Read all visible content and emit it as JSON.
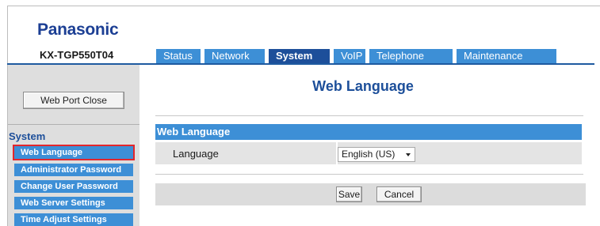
{
  "header": {
    "brand": "Panasonic",
    "model": "KX-TGP550T04"
  },
  "tabs": [
    {
      "label": "Status"
    },
    {
      "label": "Network"
    },
    {
      "label": "System"
    },
    {
      "label": "VoIP"
    },
    {
      "label": "Telephone"
    },
    {
      "label": "Maintenance"
    }
  ],
  "sidebar": {
    "port_button": "Web Port Close",
    "section_title": "System",
    "items": [
      {
        "label": "Web Language"
      },
      {
        "label": "Administrator Password"
      },
      {
        "label": "Change User Password"
      },
      {
        "label": "Web Server Settings"
      },
      {
        "label": "Time Adjust Settings"
      }
    ]
  },
  "main": {
    "page_title": "Web Language",
    "section_title": "Web Language",
    "language_label": "Language",
    "language_value": "English (US)",
    "save_label": "Save",
    "cancel_label": "Cancel"
  },
  "colors": {
    "brand": "#1c3f94",
    "tab": "#3d8fd6",
    "tab_active": "#1d4f9a",
    "highlight": "#e3262b"
  }
}
